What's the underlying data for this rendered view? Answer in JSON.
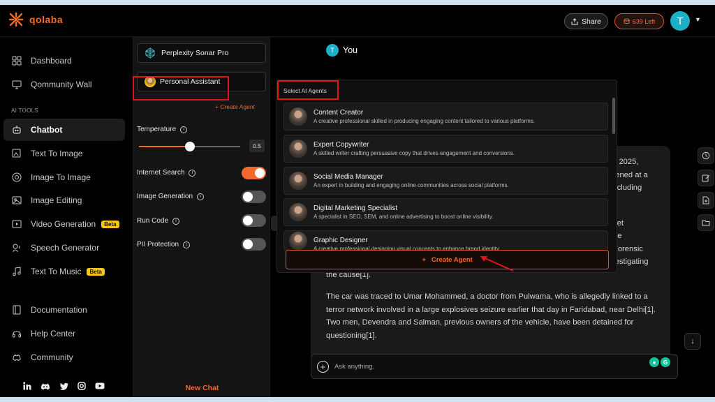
{
  "app": {
    "brand": "qolaba",
    "accent": "#f06a30",
    "highlight": "#e1141c"
  },
  "header": {
    "share_label": "Share",
    "credits_label": "639 Left",
    "avatar_initial": "T"
  },
  "sidebar": {
    "top_items": [
      {
        "label": "Dashboard",
        "icon": "grid-icon"
      },
      {
        "label": "Qommunity Wall",
        "icon": "monitor-icon"
      }
    ],
    "section_label": "AI TOOLS",
    "tool_items": [
      {
        "label": "Chatbot",
        "icon": "robot-icon",
        "active": true
      },
      {
        "label": "Text To Image",
        "icon": "image-edit-icon"
      },
      {
        "label": "Image To Image",
        "icon": "target-icon"
      },
      {
        "label": "Image Editing",
        "icon": "photo-icon"
      },
      {
        "label": "Video Generation",
        "icon": "video-icon",
        "badge": "Beta"
      },
      {
        "label": "Speech Generator",
        "icon": "speech-icon"
      },
      {
        "label": "Text To Music",
        "icon": "music-icon",
        "badge": "Beta"
      }
    ],
    "bottom_items": [
      {
        "label": "Documentation",
        "icon": "book-icon"
      },
      {
        "label": "Help Center",
        "icon": "headset-icon"
      },
      {
        "label": "Community",
        "icon": "discord-icon"
      }
    ],
    "socials": [
      "linkedin-icon",
      "discord-icon",
      "twitter-icon",
      "instagram-icon",
      "youtube-icon"
    ]
  },
  "panel": {
    "model": "Perplexity Sonar Pro",
    "assistant": "Personal Assistant",
    "create_agent_link": "+ Create Agent",
    "temperature_label": "Temperature",
    "temperature_value": "0.5",
    "temperature_fraction": 0.5,
    "toggles": [
      {
        "label": "Internet Search",
        "on": true
      },
      {
        "label": "Image Generation",
        "on": false
      },
      {
        "label": "Run Code",
        "on": false
      },
      {
        "label": "PII Protection",
        "on": false
      }
    ],
    "new_chat": "New Chat"
  },
  "main": {
    "you_label": "You",
    "you_initial": "T",
    "answer_fragments": [
      "0, 2025,",
      "pened at a",
      "including",
      "yet",
      "he",
      "Forensic",
      "vestigating"
    ],
    "answer_line_cause": "the cause[1].",
    "answer_paragraph": "The car was traced to Umar Mohammed, a doctor from Pulwama, who is allegedly linked to a terror network involved in a large explosives seizure earlier that day in Faridabad, near Delhi[1]. Two men, Devendra and Salman, previous owners of the vehicle, have been detained for questioning[1].",
    "ask_placeholder": "Ask anything."
  },
  "agents": {
    "title": "Select AI Agents",
    "items": [
      {
        "name": "Content Creator",
        "desc": "A creative professional skilled in producing engaging content tailored to various platforms."
      },
      {
        "name": "Expert Copywriter",
        "desc": "A skilled writer crafting persuasive copy that drives engagement and conversions."
      },
      {
        "name": "Social Media Manager",
        "desc": "An expert in building and engaging online communities across social platforms."
      },
      {
        "name": "Digital Marketing Specialist",
        "desc": "A specialist in SEO, SEM, and online advertising to boost online visibility."
      },
      {
        "name": "Graphic Designer",
        "desc": "A creative professional designing visual concepts to enhance brand identity."
      }
    ],
    "create_button": "Create Agent"
  }
}
